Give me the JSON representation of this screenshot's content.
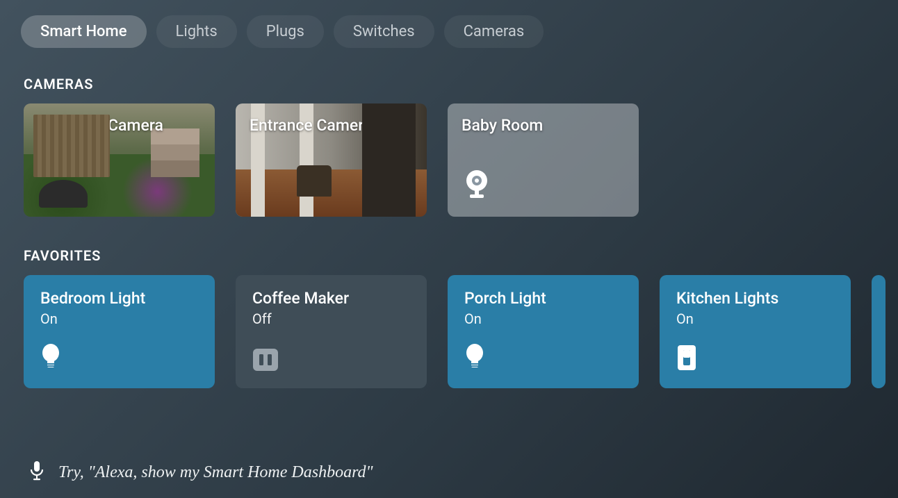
{
  "tabs": [
    {
      "label": "Smart Home",
      "active": true
    },
    {
      "label": "Lights",
      "active": false
    },
    {
      "label": "Plugs",
      "active": false
    },
    {
      "label": "Switches",
      "active": false
    },
    {
      "label": "Cameras",
      "active": false
    }
  ],
  "sections": {
    "cameras_header": "CAMERAS",
    "favorites_header": "FAVORITES"
  },
  "cameras": [
    {
      "label": "Backyard Camera",
      "scene": "backyard"
    },
    {
      "label": "Entrance Camera",
      "scene": "entrance"
    },
    {
      "label": "Baby Room",
      "scene": "placeholder",
      "icon": "camera-icon"
    }
  ],
  "favorites": [
    {
      "name": "Bedroom Light",
      "state": "On",
      "on": true,
      "icon": "bulb-icon"
    },
    {
      "name": "Coffee Maker",
      "state": "Off",
      "on": false,
      "icon": "plug-icon"
    },
    {
      "name": "Porch Light",
      "state": "On",
      "on": true,
      "icon": "bulb-icon"
    },
    {
      "name": "Kitchen Lights",
      "state": "On",
      "on": true,
      "icon": "switch-icon"
    }
  ],
  "hint": "Try, \"Alexa, show my Smart Home Dashboard\"",
  "colors": {
    "tile_on": "#2a7ea7",
    "tile_off": "#3f4d57"
  }
}
